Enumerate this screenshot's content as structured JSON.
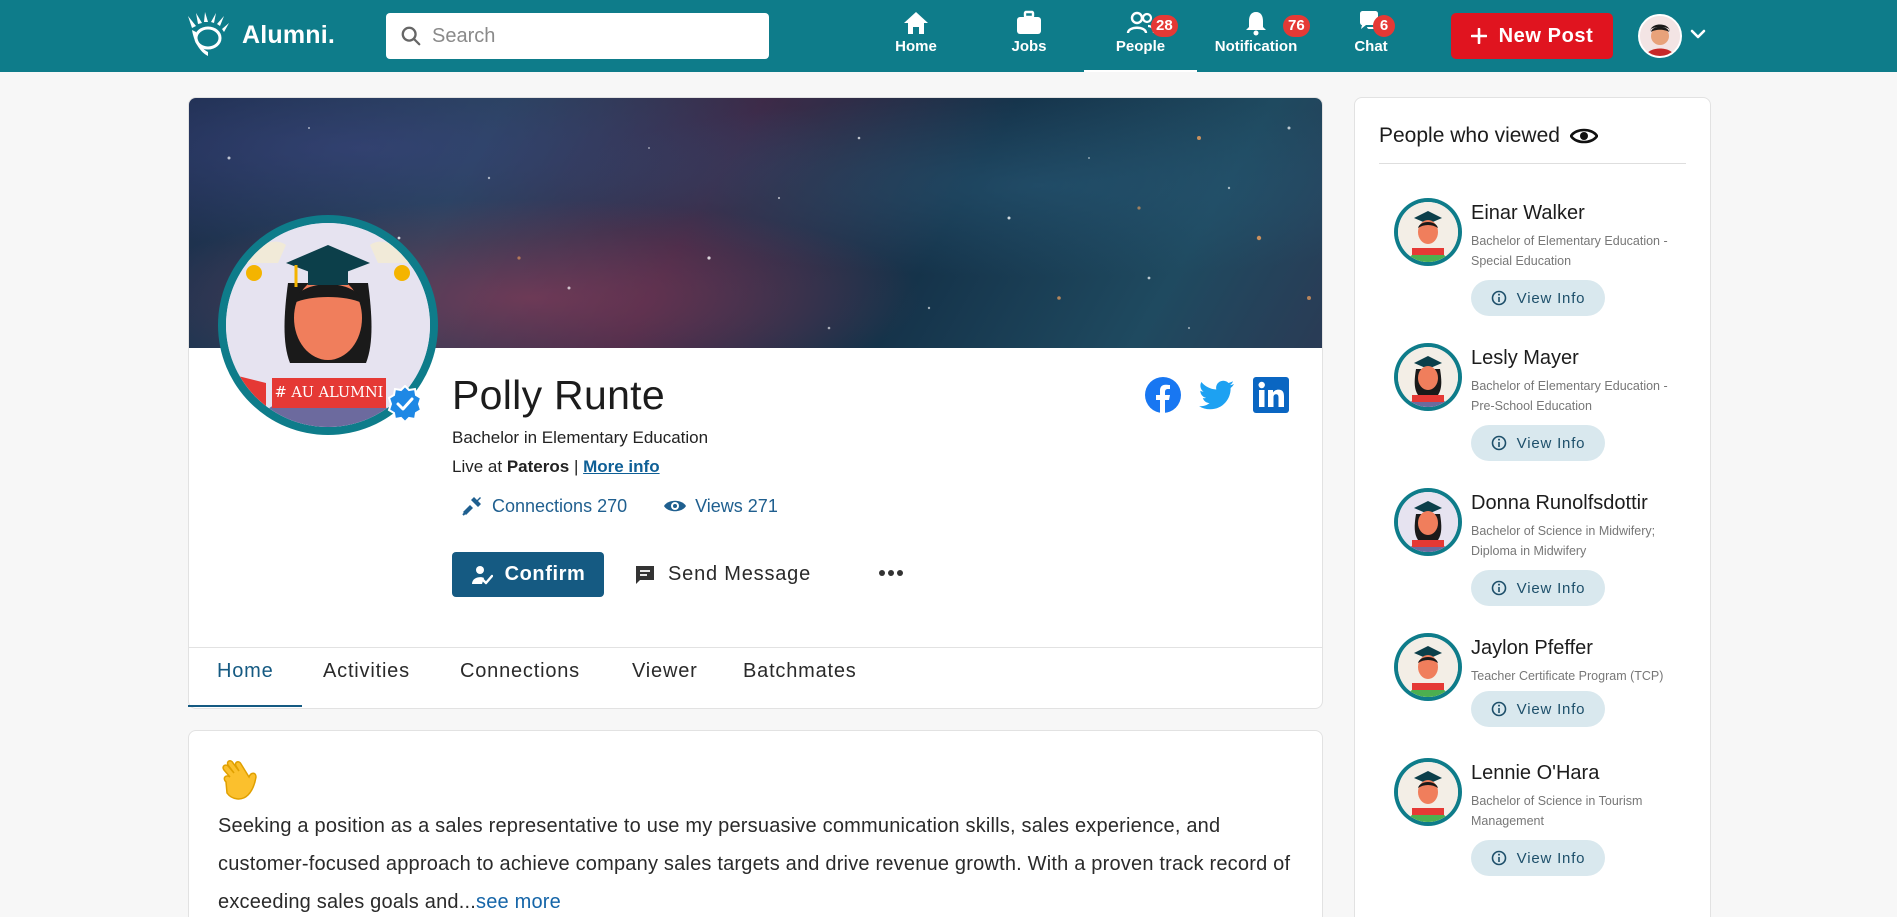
{
  "app": {
    "name": "Alumni."
  },
  "navbar": {
    "search_placeholder": "Search",
    "items": [
      {
        "label": "Home",
        "icon": "home-icon"
      },
      {
        "label": "Jobs",
        "icon": "briefcase-icon"
      },
      {
        "label": "People",
        "icon": "people-icon",
        "badge": "28",
        "active": true
      },
      {
        "label": "Notification",
        "icon": "bell-icon",
        "badge": "76"
      },
      {
        "label": "Chat",
        "icon": "chat-icon",
        "badge": "6"
      }
    ],
    "new_post_label": "New Post"
  },
  "profile": {
    "name": "Polly Runte",
    "avatar_banner": "# AU ALUMNI",
    "degree": "Bachelor in Elementary Education",
    "location_prefix": "Live at",
    "location": "Pateros",
    "separator": "|",
    "more_info": "More info",
    "connections_label": "Connections 270",
    "views_label": "Views 271",
    "confirm_label": "Confirm",
    "send_message_label": "Send Message",
    "social": [
      "facebook-icon",
      "twitter-icon",
      "linkedin-icon"
    ]
  },
  "tabs": [
    {
      "label": "Home",
      "active": true
    },
    {
      "label": "Activities"
    },
    {
      "label": "Connections"
    },
    {
      "label": "Viewer"
    },
    {
      "label": "Batchmates"
    }
  ],
  "about": {
    "text": "Seeking a position as a sales representative to use my persuasive communication skills, sales experience, and customer-focused approach to achieve company sales targets and drive revenue growth. With a proven track record of exceeding sales goals and...",
    "see_more": "see more"
  },
  "viewers": {
    "title": "People who viewed",
    "view_info_label": "View Info",
    "people": [
      {
        "name": "Einar Walker",
        "degree": "Bachelor of Elementary Education - Special Education"
      },
      {
        "name": "Lesly Mayer",
        "degree": "Bachelor of Elementary Education - Pre-School Education"
      },
      {
        "name": "Donna Runolfsdottir",
        "degree": "Bachelor of Science in Midwifery; Diploma in Midwifery"
      },
      {
        "name": "Jaylon Pfeffer",
        "degree": "Teacher Certificate Program (TCP)"
      },
      {
        "name": "Lennie O'Hara",
        "degree": "Bachelor of Science in Tourism Management"
      }
    ]
  },
  "colors": {
    "navbar": "#0e7c8a",
    "new_post": "#e0141f",
    "badge": "#e53935",
    "primary": "#155a82",
    "link": "#1565a8"
  }
}
